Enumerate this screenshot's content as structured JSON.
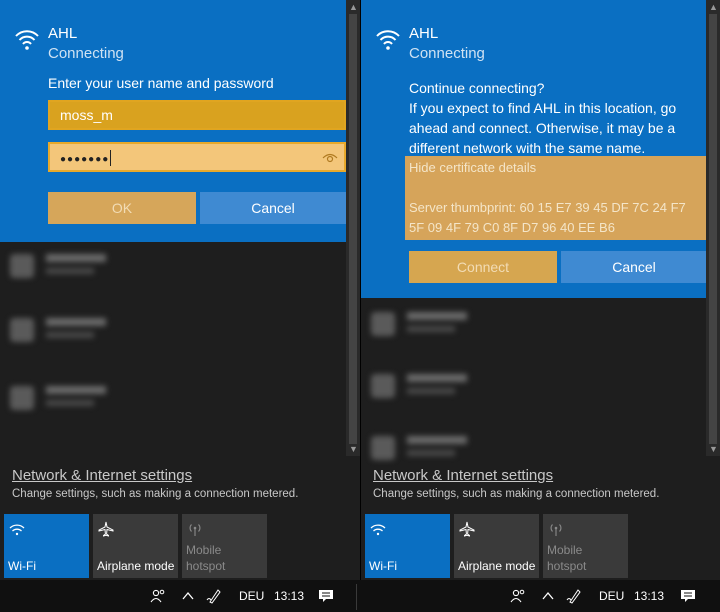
{
  "left": {
    "ssid": "AHL",
    "status": "Connecting",
    "prompt": "Enter your user name and password",
    "username_value": "moss_m",
    "password_mask": "●●●●●●●",
    "ok_label": "OK",
    "cancel_label": "Cancel"
  },
  "right": {
    "ssid": "AHL",
    "status": "Connecting",
    "question": "Continue connecting?",
    "body": "If you expect to find AHL  in this location, go ahead and connect. Otherwise, it may be a different network with the same name.",
    "cert_toggle": "Hide certificate details",
    "cert_thumbprint": "Server thumbprint: 60 15 E7 39 45 DF 7C 24 F7 5F 09 4F 79 C0 8F D7 96 40 EE B6",
    "connect_label": "Connect",
    "cancel_label": "Cancel"
  },
  "bottom": {
    "settings_link": "Network & Internet settings",
    "settings_sub": "Change settings, such as making a connection metered.",
    "tiles": {
      "wifi": "Wi-Fi",
      "airplane": "Airplane mode",
      "hotspot_line1": "Mobile",
      "hotspot_line2": "hotspot"
    }
  },
  "taskbar": {
    "language": "DEU",
    "time": "13:13"
  },
  "colors": {
    "accent": "#0a6fc2",
    "highlight": "#d9a21f"
  }
}
